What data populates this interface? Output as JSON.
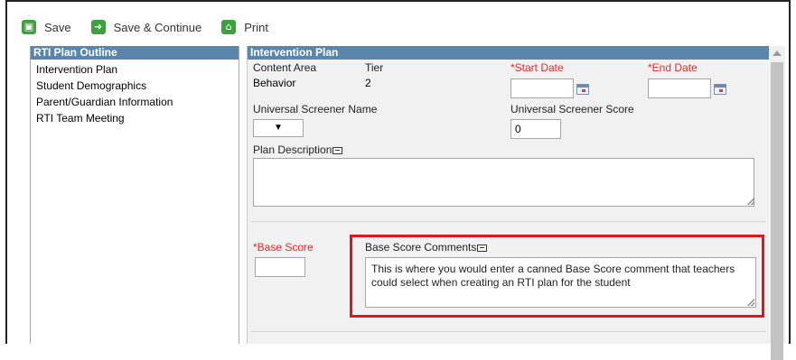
{
  "toolbar": {
    "save_label": "Save",
    "save_continue_label": "Save & Continue",
    "print_label": "Print"
  },
  "outline": {
    "header": "RTI Plan Outline",
    "items": [
      "Intervention Plan",
      "Student Demographics",
      "Parent/Guardian Information",
      "RTI Team Meeting"
    ]
  },
  "plan": {
    "header": "Intervention Plan",
    "content_area_label": "Content Area",
    "content_area_value": "Behavior",
    "tier_label": "Tier",
    "tier_value": "2",
    "start_date_label": "*Start Date",
    "start_date_value": "",
    "end_date_label": "*End Date",
    "end_date_value": "",
    "screener_name_label": "Universal Screener Name",
    "screener_name_value": "",
    "screener_score_label": "Universal Screener Score",
    "screener_score_value": "0",
    "description_label": "Plan Description",
    "description_value": "",
    "base_score_label": "*Base Score",
    "base_score_value": "",
    "base_comments_label": "Base Score Comments",
    "base_comments_value": "This is where you would enter a canned Base Score comment that teachers could select when creating an RTI plan for the student"
  },
  "colors": {
    "header_bg": "#5a86ab",
    "required_red": "#e8282a",
    "highlight_red": "#e2151c",
    "toolbar_green": "#3da13d"
  },
  "icons": {
    "save": "save-icon",
    "save_continue": "arrow-right-icon",
    "print": "print-icon"
  }
}
